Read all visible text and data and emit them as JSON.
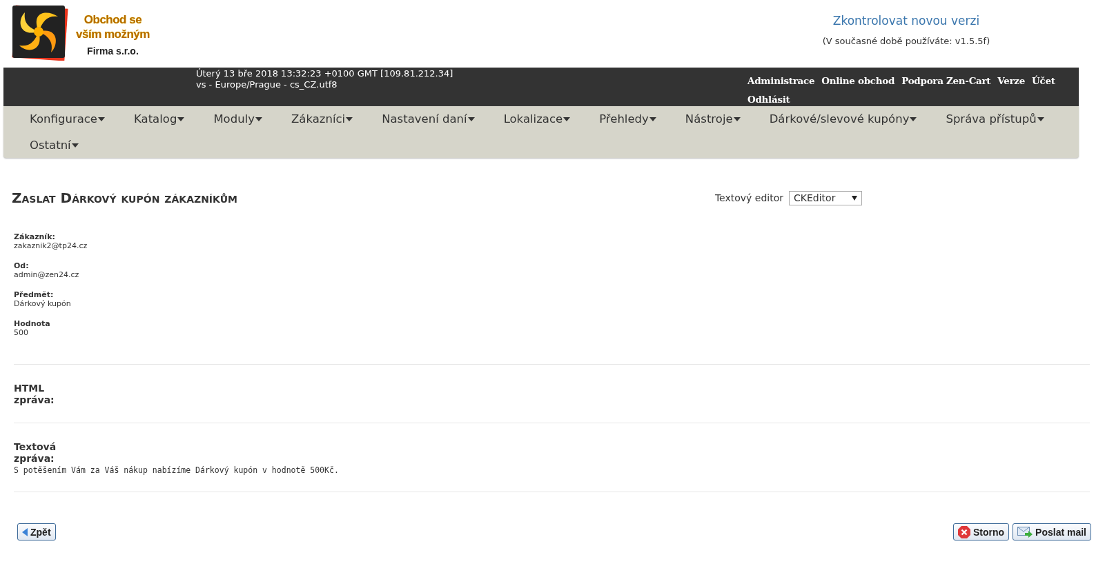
{
  "logo": {
    "lines": [
      "Obchod se",
      "vším možným"
    ],
    "company": "Firma s.r.o."
  },
  "version": {
    "link": "Zkontrolovat novou verzi",
    "current": "(V současné době používáte: v1.5.5f)"
  },
  "server_info": [
    "Úterý 13 bře 2018 13:32:23 +0100 GMT [109.81.212.34]",
    "vs - Europe/Prague - cs_CZ.utf8"
  ],
  "top_links": [
    "Administrace",
    "Online obchod",
    "Podpora Zen-Cart",
    "Verze",
    "Účet",
    "Odhlásit"
  ],
  "menu": [
    "Konfigurace",
    "Katalog",
    "Moduly",
    "Zákazníci",
    "Nastavení daní",
    "Lokalizace",
    "Přehledy",
    "Nástroje",
    "Dárkové/slevové kupóny",
    "Správa přístupů",
    "Ostatní"
  ],
  "page_title": "Zaslat Dárkový kupón zákazníkům",
  "editor": {
    "label": "Textový editor",
    "value": "CKEditor"
  },
  "fields": [
    {
      "label": "Zákazník:",
      "value": "zakaznik2@tp24.cz"
    },
    {
      "label": "Od:",
      "value": "admin@zen24.cz"
    },
    {
      "label": "Předmět:",
      "value": "Dárkový kupón"
    },
    {
      "label": "Hodnota",
      "value": "500"
    }
  ],
  "html_message": {
    "label": [
      "HTML",
      "zpráva:"
    ]
  },
  "text_message": {
    "label": [
      "Textová",
      "zpráva:"
    ],
    "value": "S potěšením Vám za Váš nákup nabízíme Dárkový kupón v hodnotě 500Kč."
  },
  "buttons": {
    "back": "Zpět",
    "cancel": "Storno",
    "send": "Poslat mail"
  }
}
